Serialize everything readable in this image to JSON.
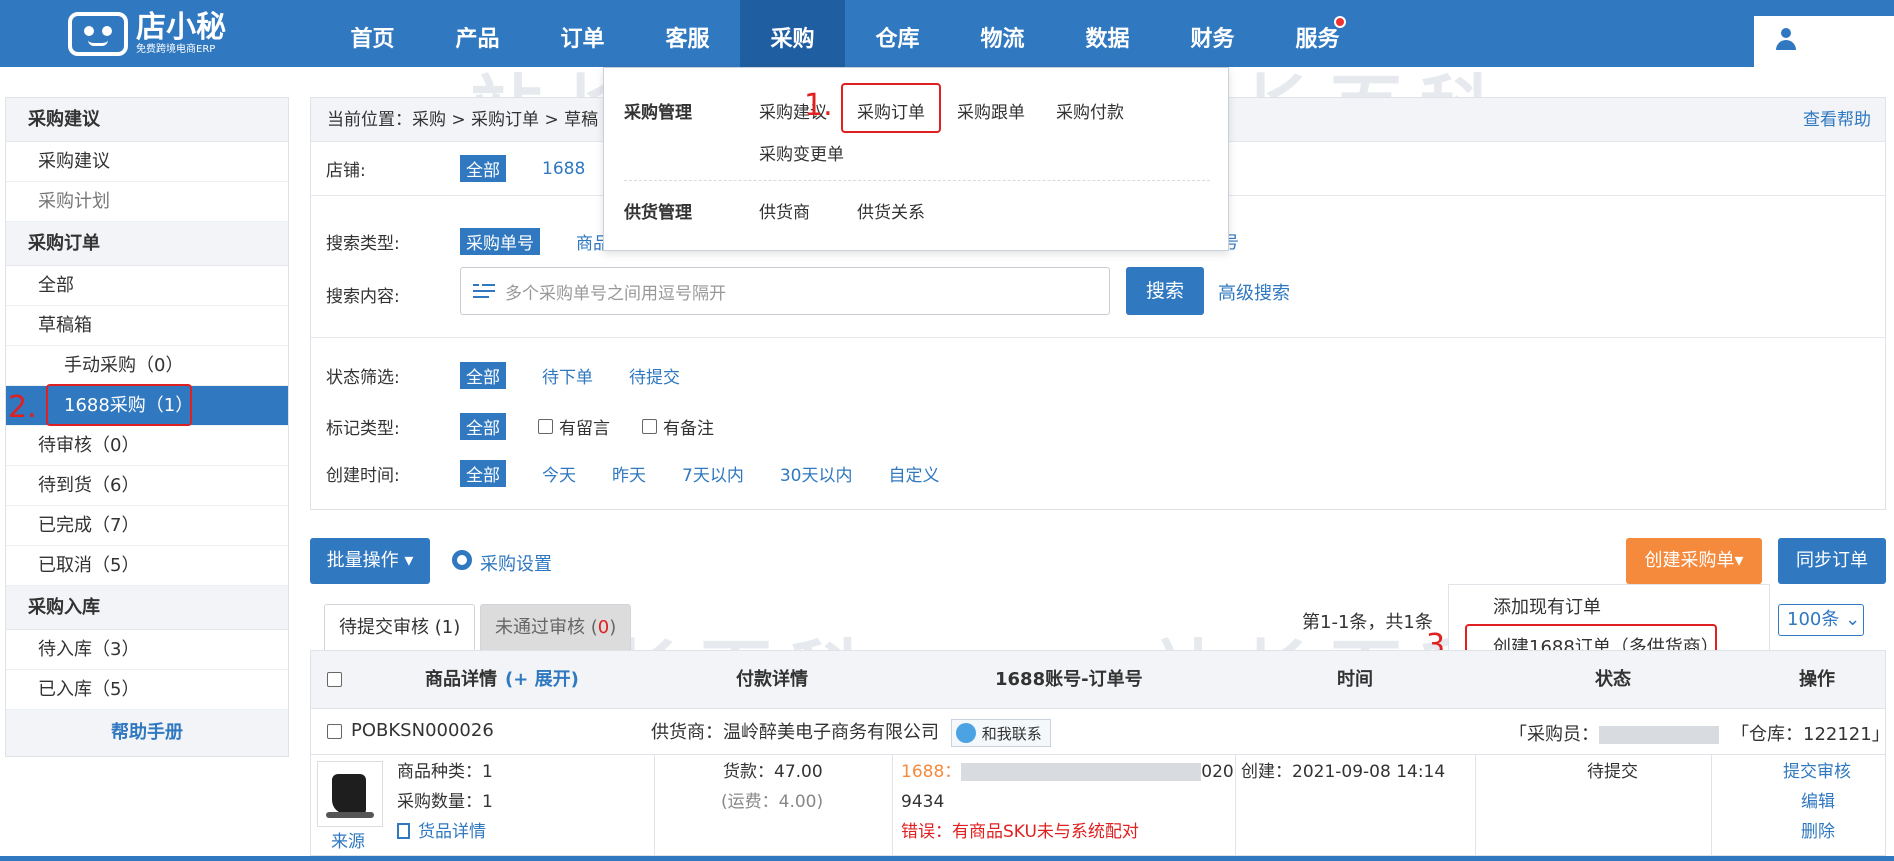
{
  "brand": {
    "name": "店小秘",
    "tagline": "免费跨境电商ERP"
  },
  "nav": {
    "items": [
      "首页",
      "产品",
      "订单",
      "客服",
      "采购",
      "仓库",
      "物流",
      "数据",
      "财务",
      "服务"
    ],
    "active": "采购"
  },
  "dropdown": {
    "group1_label": "采购管理",
    "group1_links": [
      "采购建议",
      "采购订单",
      "采购跟单",
      "采购付款"
    ],
    "group1_extra": "采购变更单",
    "group2_label": "供货管理",
    "group2_links": [
      "供货商",
      "供货关系"
    ]
  },
  "sidebar": {
    "sections": [
      {
        "title": "采购建议",
        "items": [
          "采购建议",
          "采购计划"
        ]
      },
      {
        "title": "采购订单",
        "items": [
          "全部",
          "草稿箱",
          "手动采购（0）",
          "1688采购（1）",
          "待审核（0）",
          "待到货（6）",
          "已完成（7）",
          "已取消（5）"
        ]
      },
      {
        "title": "采购入库",
        "items": [
          "待入库（3）",
          "已入库（5）"
        ]
      }
    ],
    "help": "帮助手册"
  },
  "annotations": {
    "step1": "1.",
    "step2": "2.",
    "step3": "3."
  },
  "breadcrumb": {
    "prefix": "当前位置：",
    "path": "采购 > 采购订单 > 草稿",
    "help": "查看帮助"
  },
  "filters": {
    "shop_label": "店铺:",
    "shop_all": "全部",
    "shop_1688": "1688",
    "search_type_label": "搜索类型:",
    "search_type_selected": "采购单号",
    "search_type_other": "商品",
    "search_type_tail": "号",
    "search_content_label": "搜索内容:",
    "search_placeholder": "多个采购单号之间用逗号隔开",
    "search_button": "搜索",
    "advanced_search": "高级搜索",
    "status_label": "状态筛选:",
    "status_all": "全部",
    "status_options": [
      "待下单",
      "待提交"
    ],
    "mark_label": "标记类型:",
    "mark_all": "全部",
    "mark_options": [
      "有留言",
      "有备注"
    ],
    "time_label": "创建时间:",
    "time_all": "全部",
    "time_options": [
      "今天",
      "昨天",
      "7天以内",
      "30天以内",
      "自定义"
    ]
  },
  "toolbar": {
    "batch": "批量操作 ▾",
    "settings": "采购设置",
    "create": "创建采购单▾",
    "sync": "同步订单",
    "create_menu": [
      "添加现有订单",
      "创建1688订单（多供货商）"
    ]
  },
  "tabs": {
    "pending": "待提交审核 (1)",
    "rejected_prefix": "未通过审核 (",
    "rejected_count": "0",
    "rejected_suffix": ")"
  },
  "pager": {
    "info": "第1-1条，共1条",
    "size": "100条 ⌄"
  },
  "table": {
    "headers": [
      "商品详情",
      "(+ 展开)",
      "付款详情",
      "1688账号-订单号",
      "时间",
      "状态",
      "操作"
    ],
    "order": {
      "id": "POBKSN000026",
      "supplier_label": "供货商：",
      "supplier": "温岭醉美电子商务有限公司",
      "contact": "和我联系",
      "buyer_label": "「采购员：",
      "warehouse": "「仓库：122121」",
      "kinds": "商品种类：1",
      "qty": "采购数量：1",
      "detail": "货品详情",
      "source": "来源",
      "payment": "货款：47.00",
      "freight": "(运费：4.00)",
      "account_label": "1688：",
      "account_tail": "020",
      "order_tail": "9434",
      "error": "错误：有商品SKU未与系统配对",
      "created": "创建：2021-09-08 14:14",
      "status": "待提交",
      "actions": [
        "提交审核",
        "编辑",
        "删除"
      ]
    }
  },
  "watermark": "站长百科",
  "colors": {
    "brand": "#3078c0",
    "accent": "#f58a3c",
    "error": "#e02020"
  }
}
